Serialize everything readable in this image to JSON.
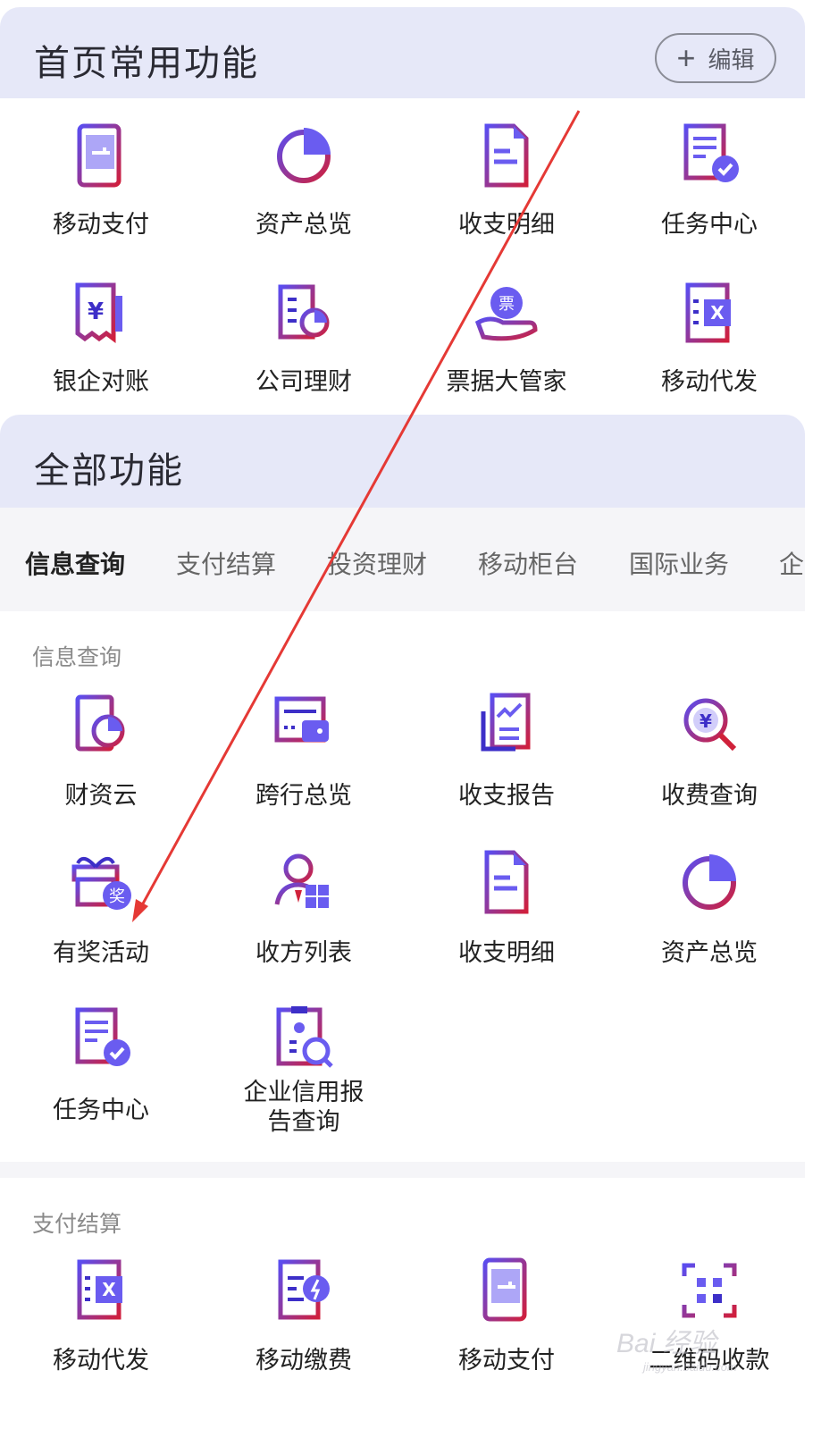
{
  "home_section": {
    "title": "首页常用功能",
    "edit_label": "编辑"
  },
  "home_items": [
    "移动支付",
    "资产总览",
    "收支明细",
    "任务中心",
    "银企对账",
    "公司理财",
    "票据大管家",
    "移动代发"
  ],
  "all_section": {
    "title": "全部功能"
  },
  "tabs": [
    "信息查询",
    "支付结算",
    "投资理财",
    "移动柜台",
    "国际业务",
    "企业"
  ],
  "info_section": {
    "title": "信息查询"
  },
  "info_items": [
    "财资云",
    "跨行总览",
    "收支报告",
    "收费查询",
    "有奖活动",
    "收方列表",
    "收支明细",
    "资产总览",
    "任务中心",
    "企业信用报告查询"
  ],
  "info_item_lines": {
    "credit_line1": "企业信用报",
    "credit_line2": "告查询"
  },
  "pay_section": {
    "title": "支付结算"
  },
  "pay_items": [
    "移动代发",
    "移动缴费",
    "移动支付",
    "二维码收款"
  ],
  "badges": {
    "prize": "奖",
    "bill": "票",
    "yen": "¥",
    "excel": "X"
  },
  "watermark": {
    "main": "Bai 经验",
    "sub": "jingyan.baidu.com"
  },
  "colors": {
    "accent_purple": "#6a5cf0",
    "accent_red": "#d0213a",
    "header_bg": "#e6e8f8",
    "arrow": "#e53935"
  }
}
